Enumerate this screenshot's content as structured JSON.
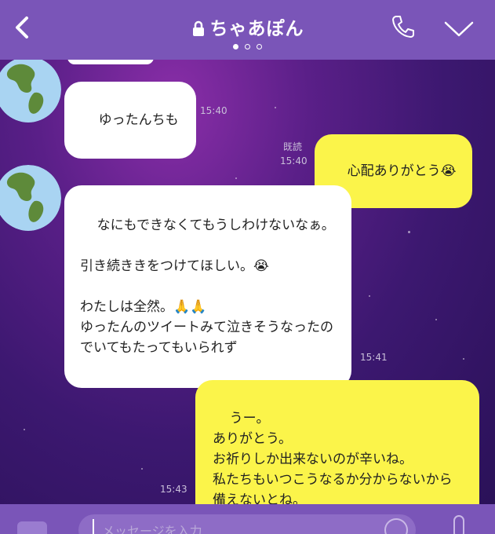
{
  "header": {
    "title": "ちゃあぽん",
    "page_indicator": {
      "count": 3,
      "active": 1
    }
  },
  "icons": {
    "back": "back-arrow-icon",
    "lock": "lock-icon",
    "phone": "phone-icon",
    "more": "chevron-down-icon"
  },
  "messages": [
    {
      "side": "in",
      "text": "ゆったんちも",
      "time": "15:40"
    },
    {
      "side": "out",
      "text": "心配ありがとう😭",
      "time": "15:40",
      "read": "既読"
    },
    {
      "side": "in",
      "text": "なにもできなくてもうしわけないなぁ。\n\n引き続ききをつけてほしい。😭\n\nわたしは全然。🙏🙏\nゆったんのツイートみて泣きそうなったのでいてもたってもいられず",
      "time": "15:41"
    },
    {
      "side": "out",
      "text": "うー。\nありがとう。\nお祈りしか出来ないのが辛いね。\n私たちもいつこうなるか分からないから備えないとね。",
      "time": "15:43"
    }
  ],
  "input": {
    "placeholder": "メッセージを入力"
  },
  "colors": {
    "header": "#7a55b8",
    "outgoing_bubble": "#fbf44a",
    "incoming_bubble": "#ffffff",
    "timestamp": "#c9bfd9"
  }
}
